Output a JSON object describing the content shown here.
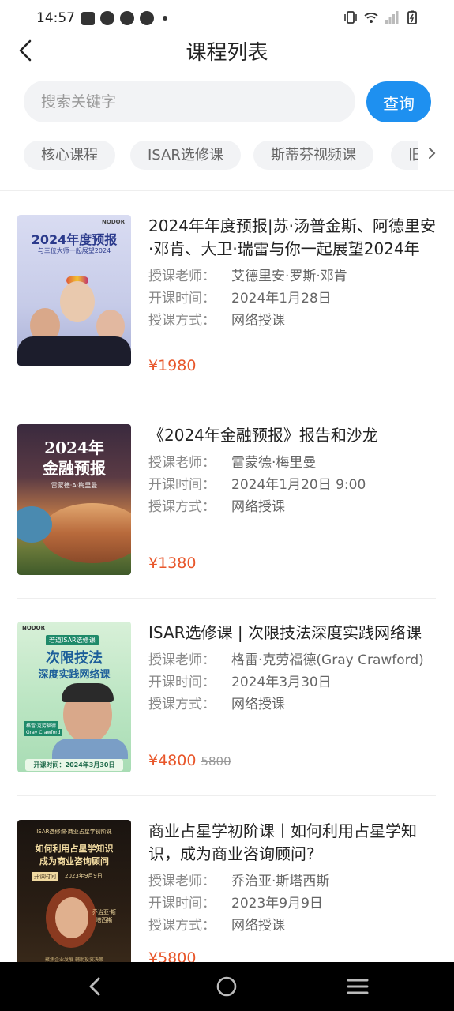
{
  "status_bar": {
    "time": "14:57"
  },
  "header": {
    "title": "课程列表"
  },
  "search": {
    "placeholder": "搜索关键字",
    "button_label": "查询"
  },
  "categories": [
    "核心课程",
    "ISAR选修课",
    "斯蒂芬视频课",
    "旧"
  ],
  "courses": [
    {
      "title": "2024年年度预报|苏·汤普金斯、阿德里安·邓肯、大卫·瑞雷与你一起展望2024年",
      "teacher_label": "授课老师：",
      "teacher": "艾德里安·罗斯·邓肯",
      "time_label": "开课时间：",
      "time": "2024年1月28日",
      "mode_label": "授课方式：",
      "mode": "网络授课",
      "price": "¥1980",
      "original_price": "",
      "thumb": {
        "logo": "NODOR",
        "headline": "2024年度预报",
        "subline": "与三位大师一起展望2024"
      }
    },
    {
      "title": "《2024年金融预报》报告和沙龙",
      "teacher_label": "授课老师：",
      "teacher": "雷蒙德·梅里曼",
      "time_label": "开课时间：",
      "time": "2024年1月20日 9:00",
      "mode_label": "授课方式：",
      "mode": "网络授课",
      "price": "¥1380",
      "original_price": "",
      "thumb": {
        "headline1": "2024年",
        "headline2": "金融预报",
        "subline": "雷蒙德·A·梅里曼"
      }
    },
    {
      "title": "ISAR选修课 | 次限技法深度实践网络课",
      "teacher_label": "授课老师：",
      "teacher": "格雷·克劳福德(Gray Crawford)",
      "time_label": "开课时间：",
      "time": "2024年3月30日",
      "mode_label": "授课方式：",
      "mode": "网络授课",
      "price": "¥4800",
      "original_price": "5800",
      "thumb": {
        "logo": "NODOR",
        "tag": "若道ISAR选修课",
        "headline1": "次限技法",
        "headline2": "深度实践网络课",
        "name_cn": "格雷·克劳福德",
        "name_en": "Gray Crawford",
        "date_line": "开课时间：2024年3月30日"
      }
    },
    {
      "title": "商业占星学初阶课丨如何利用占星学知识，成为商业咨询顾问?",
      "teacher_label": "授课老师：",
      "teacher": "乔治亚·斯塔西斯",
      "time_label": "开课时间：",
      "time": "2023年9月9日",
      "mode_label": "授课方式：",
      "mode": "网络授课",
      "price": "¥5800",
      "original_price": "",
      "thumb": {
        "tag": "ISAR选修课·商业占星学初阶课",
        "headline1": "如何利用占星学知识",
        "headline2": "成为商业咨询顾问",
        "date_label": "开课时间",
        "date": "2023年9月9日",
        "name": "乔治亚·斯塔西斯",
        "footer": "聚焦企业发展 辅助投资决策"
      }
    }
  ],
  "colors": {
    "accent": "#1e90f0",
    "price": "#e8562a",
    "chip_bg": "#f2f3f5"
  },
  "icons": [
    "back-arrow-icon",
    "chevron-right-icon",
    "nav-back-icon",
    "nav-home-icon",
    "nav-menu-icon"
  ]
}
